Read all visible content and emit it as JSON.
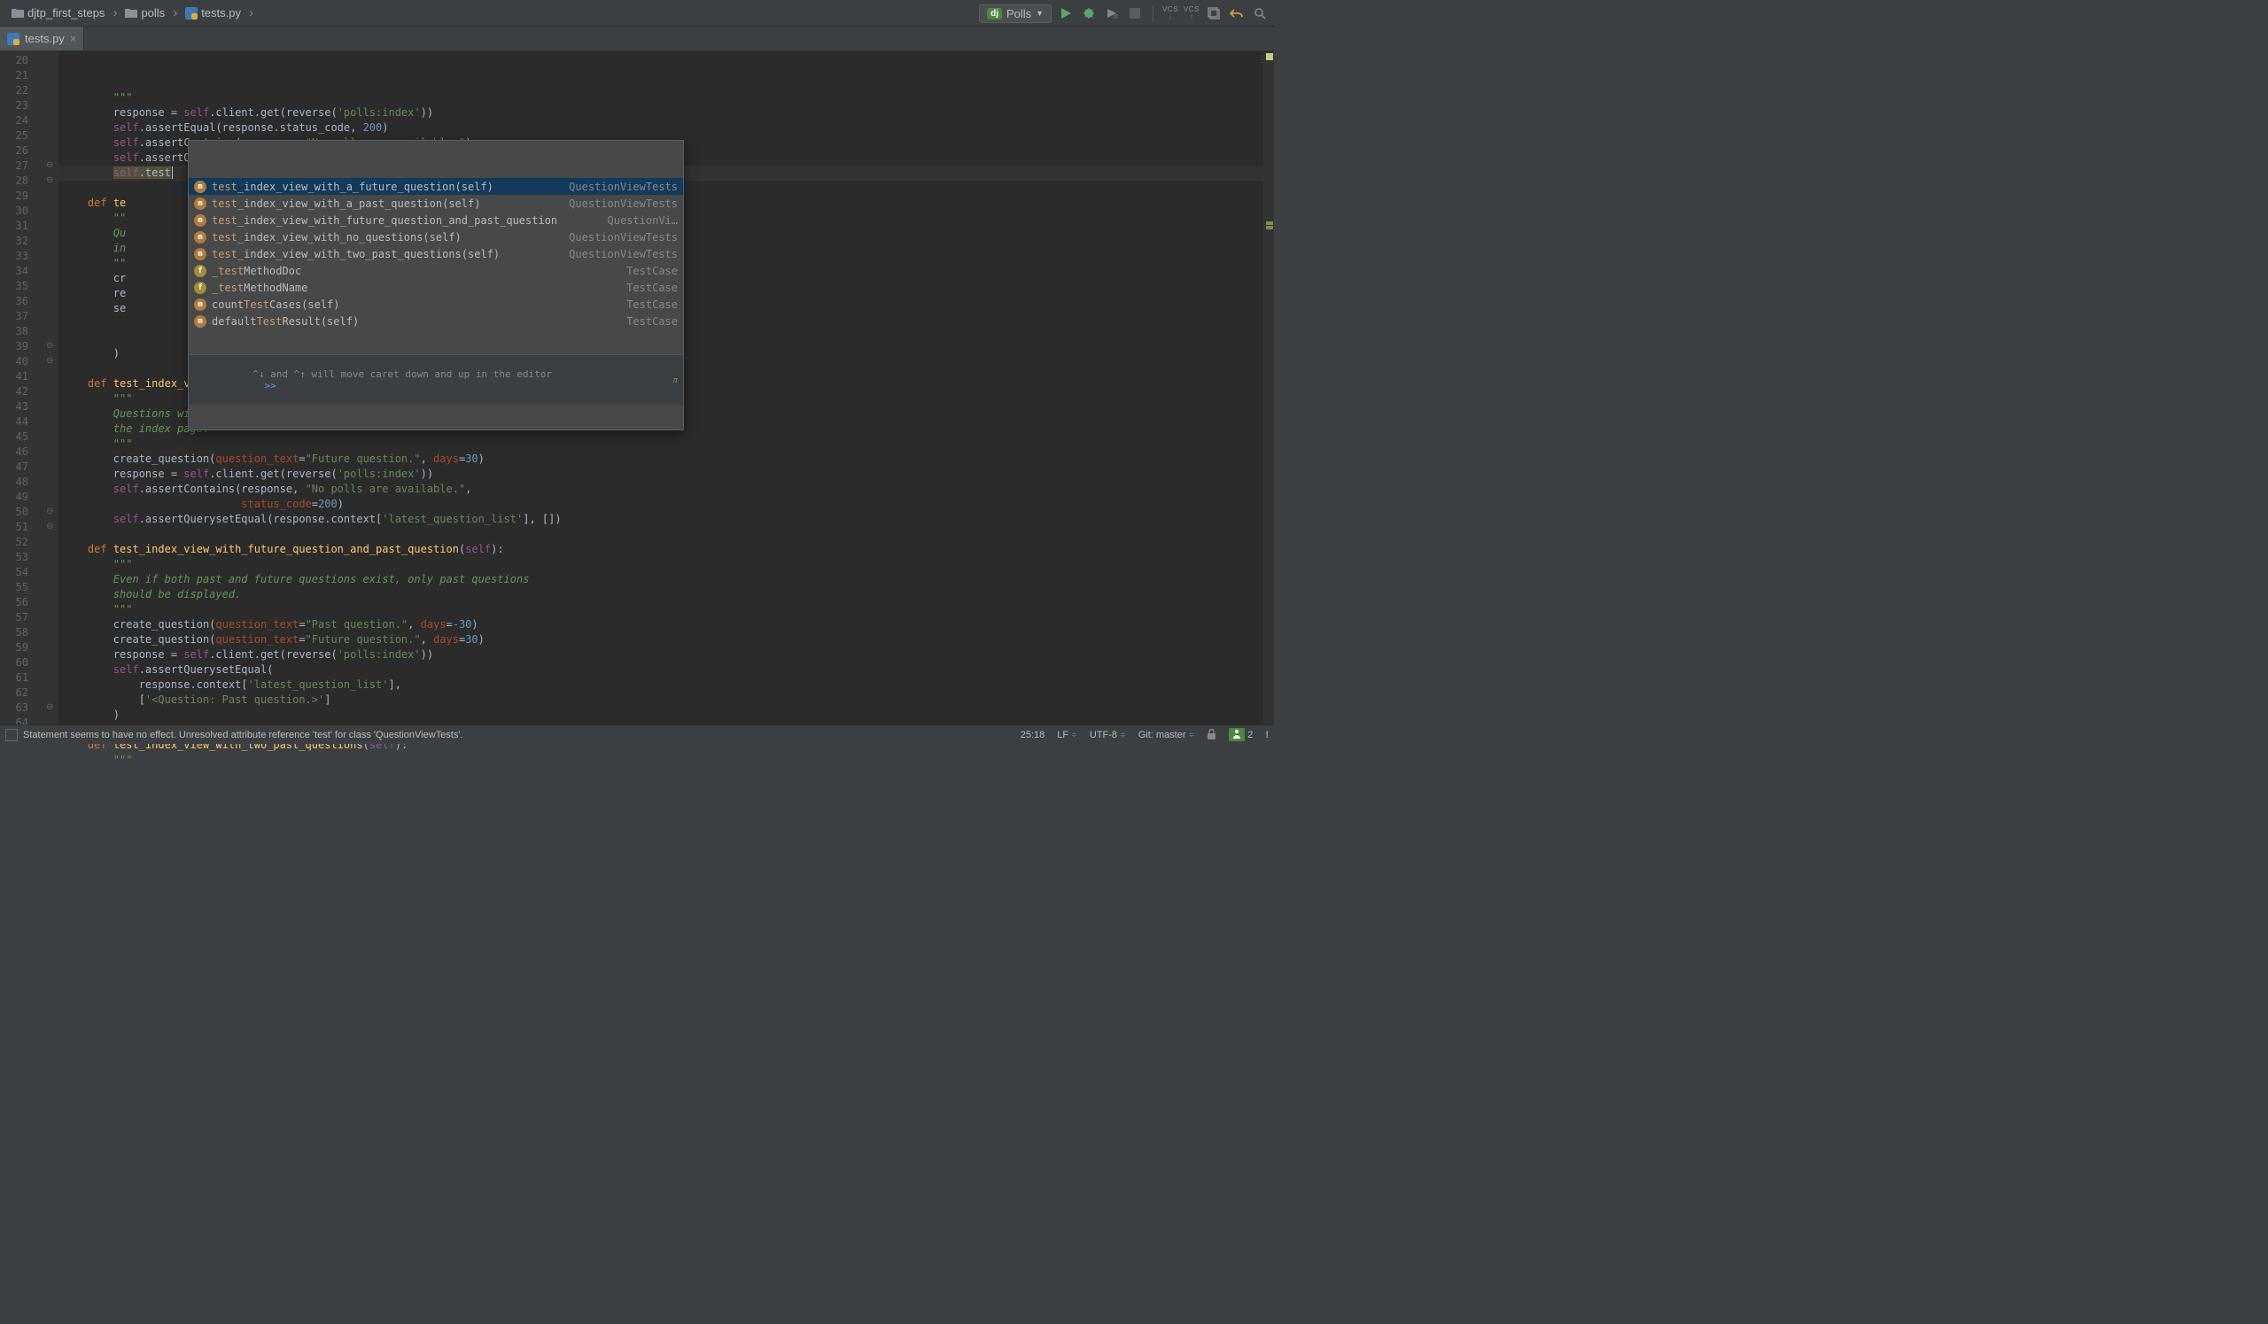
{
  "breadcrumbs": [
    {
      "label": "djtp_first_steps",
      "icon": "folder"
    },
    {
      "label": "polls",
      "icon": "folder"
    },
    {
      "label": "tests.py",
      "icon": "python"
    }
  ],
  "run_config": {
    "badge": "dj",
    "name": "Polls"
  },
  "tab": {
    "filename": "tests.py"
  },
  "gutter": {
    "start": 20,
    "end": 64
  },
  "code_lines": [
    {
      "n": 20,
      "html": "        <span class='triple'>\"\"\"</span>"
    },
    {
      "n": 21,
      "html": "        response = <span class='self'>self</span>.client.get(reverse(<span class='str'>'polls:index'</span>))"
    },
    {
      "n": 22,
      "html": "        <span class='self'>self</span>.assertEqual(response.status_code, <span class='num'>200</span>)"
    },
    {
      "n": 23,
      "html": "        <span class='self'>self</span>.assertContains(response, <span class='str'>\"No polls are available.\"</span>)"
    },
    {
      "n": 24,
      "html": "        <span class='self'>self</span>.assertQuerysetEqual(response.context[<span class='str'>'latest_question_list'</span>], [])"
    },
    {
      "n": 25,
      "current": true,
      "html": "        <span class='self' style='background:#52503a'>self</span><span style='background:#52503a'>.test</span><span class='caret'></span>"
    },
    {
      "n": 26,
      "html": ""
    },
    {
      "n": 27,
      "html": "    <span class='kw'>def </span><span class='func'>te</span>"
    },
    {
      "n": 28,
      "html": "        <span class='triple'>\"\"</span>"
    },
    {
      "n": 29,
      "html": "        <span class='docstr'>Qu</span>"
    },
    {
      "n": 30,
      "html": "        <span class='docstr'>in</span>"
    },
    {
      "n": 31,
      "html": "        <span class='triple'>\"\"</span>"
    },
    {
      "n": 32,
      "html": "        cr"
    },
    {
      "n": 33,
      "html": "        re"
    },
    {
      "n": 34,
      "html": "        se"
    },
    {
      "n": 35,
      "html": ""
    },
    {
      "n": 36,
      "html": ""
    },
    {
      "n": 37,
      "html": "        )"
    },
    {
      "n": 38,
      "html": ""
    },
    {
      "n": 39,
      "html": "    <span class='kw'>def </span><span class='func'>test_index_view_with_a_future_question</span>(<span class='self'>self</span>):"
    },
    {
      "n": 40,
      "html": "        <span class='triple'>\"\"\"</span>"
    },
    {
      "n": 41,
      "html": "        <span class='docstr'>Questions with a pub_date in the future should not be displayed on</span>"
    },
    {
      "n": 42,
      "html": "        <span class='docstr'>the index page.</span>"
    },
    {
      "n": 43,
      "html": "        <span class='triple'>\"\"\"</span>"
    },
    {
      "n": 44,
      "html": "        create_question(<span class='named'>question_text</span>=<span class='str'>\"Future question.\"</span>, <span class='named'>days</span>=<span class='num'>30</span>)"
    },
    {
      "n": 45,
      "html": "        response = <span class='self'>self</span>.client.get(reverse(<span class='str'>'polls:index'</span>))"
    },
    {
      "n": 46,
      "html": "        <span class='self'>self</span>.assertContains(response, <span class='str'>\"No polls are available.\"</span>,"
    },
    {
      "n": 47,
      "html": "                            <span class='named'>status_code</span>=<span class='num'>200</span>)"
    },
    {
      "n": 48,
      "html": "        <span class='self'>self</span>.assertQuerysetEqual(response.context[<span class='str'>'latest_question_list'</span>], [])"
    },
    {
      "n": 49,
      "html": ""
    },
    {
      "n": 50,
      "html": "    <span class='kw'>def </span><span class='func'>test_index_view_with_future_question_and_past_question</span>(<span class='self'>self</span>):"
    },
    {
      "n": 51,
      "html": "        <span class='triple'>\"\"\"</span>"
    },
    {
      "n": 52,
      "html": "        <span class='docstr'>Even if both past and future questions exist, only past questions</span>"
    },
    {
      "n": 53,
      "html": "        <span class='docstr'>should be displayed.</span>"
    },
    {
      "n": 54,
      "html": "        <span class='triple'>\"\"\"</span>"
    },
    {
      "n": 55,
      "html": "        create_question(<span class='named'>question_text</span>=<span class='str'>\"Past question.\"</span>, <span class='named'>days</span>=<span class='num'>-30</span>)"
    },
    {
      "n": 56,
      "html": "        create_question(<span class='named'>question_text</span>=<span class='str'>\"Future question.\"</span>, <span class='named'>days</span>=<span class='num'>30</span>)"
    },
    {
      "n": 57,
      "html": "        response = <span class='self'>self</span>.client.get(reverse(<span class='str'>'polls:index'</span>))"
    },
    {
      "n": 58,
      "html": "        <span class='self'>self</span>.assertQuerysetEqual("
    },
    {
      "n": 59,
      "html": "            response.context[<span class='str'>'latest_question_list'</span>],"
    },
    {
      "n": 60,
      "html": "            [<span class='str'>'&lt;Question: Past question.&gt;'</span>]"
    },
    {
      "n": 61,
      "html": "        )"
    },
    {
      "n": 62,
      "html": ""
    },
    {
      "n": 63,
      "html": "    <span class='kw'>def </span><span class='func'>test_index_view_with_two_past_questions</span>(<span class='self'>self</span>):"
    },
    {
      "n": 64,
      "html": "        <span class='triple'>\"\"\"</span>"
    }
  ],
  "completion": {
    "items": [
      {
        "badge": "m",
        "name": "test_index_view_with_a_future_question(self)",
        "type": "QuestionViewTests",
        "selected": true
      },
      {
        "badge": "m",
        "name": "test_index_view_with_a_past_question(self)",
        "type": "QuestionViewTests"
      },
      {
        "badge": "m",
        "name": "test_index_view_with_future_question_and_past_question",
        "type": "QuestionVi…"
      },
      {
        "badge": "m",
        "name": "test_index_view_with_no_questions(self)",
        "type": "QuestionViewTests"
      },
      {
        "badge": "m",
        "name": "test_index_view_with_two_past_questions(self)",
        "type": "QuestionViewTests"
      },
      {
        "badge": "f",
        "name": "_testMethodDoc",
        "type": "TestCase"
      },
      {
        "badge": "f",
        "name": "_testMethodName",
        "type": "TestCase"
      },
      {
        "badge": "m",
        "name": "countTestCases(self)",
        "type": "TestCase"
      },
      {
        "badge": "m",
        "name": "defaultTestResult(self)",
        "type": "TestCase"
      }
    ],
    "footer_text": "^↓ and ^↑ will move caret down and up in the editor",
    "footer_link": ">>",
    "footer_pi": "π"
  },
  "status": {
    "message": "Statement seems to have no effect. Unresolved attribute reference 'test' for class 'QuestionViewTests'.",
    "position": "25:18",
    "line_sep": "LF",
    "encoding": "UTF-8",
    "git": "Git: master",
    "indicator_count": "2"
  }
}
